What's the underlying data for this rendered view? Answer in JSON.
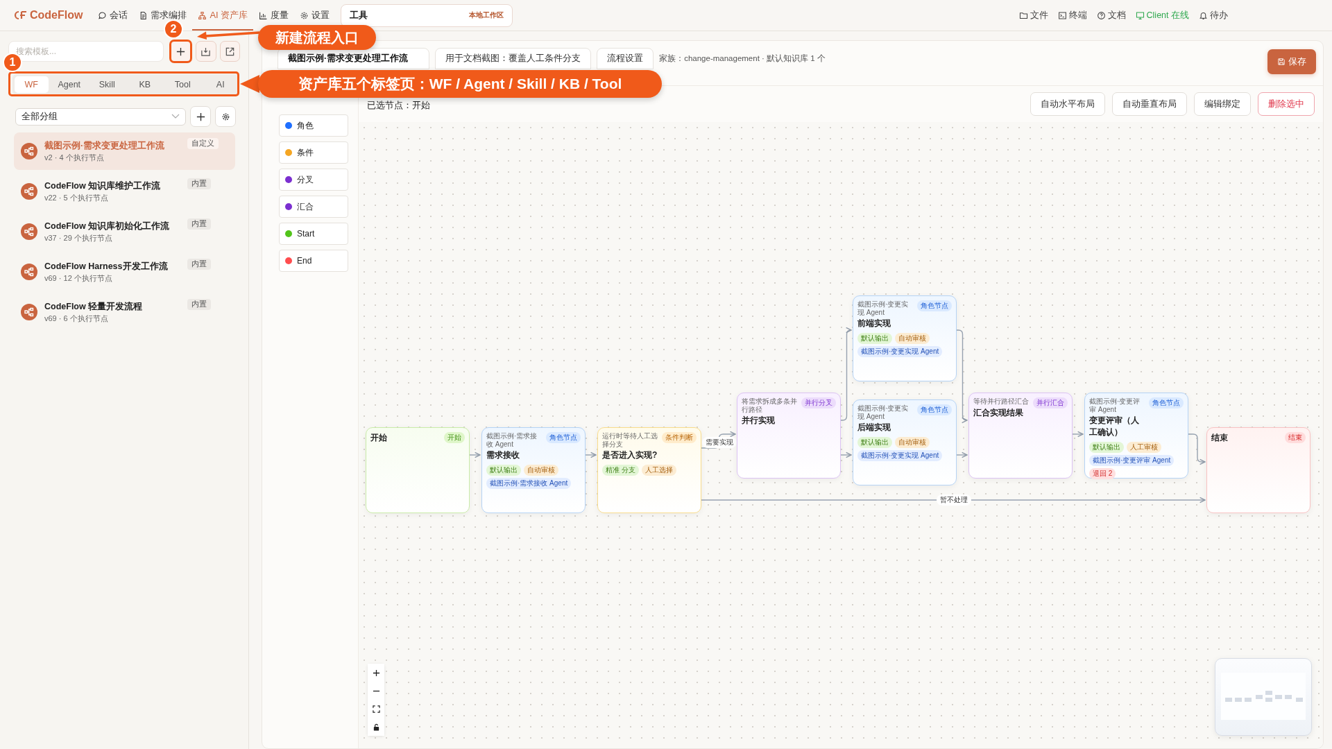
{
  "nav": {
    "logo": "CodeFlow",
    "items": [
      {
        "label": "会话",
        "selected": false
      },
      {
        "label": "需求编排",
        "selected": false
      },
      {
        "label": "AI 资产库",
        "selected": true
      },
      {
        "label": "度量",
        "selected": false
      },
      {
        "label": "设置",
        "selected": false
      }
    ],
    "workspace_tab": {
      "label": "工具",
      "badge": "本地工作区"
    },
    "right_items": [
      {
        "label": "文件",
        "online": false
      },
      {
        "label": "终端",
        "online": false
      },
      {
        "label": "文档",
        "online": false
      },
      {
        "label": "Client 在线",
        "online": true
      },
      {
        "label": "待办",
        "online": false
      }
    ]
  },
  "sidebar": {
    "search": {
      "placeholder": "搜索模板..."
    },
    "tabs": [
      {
        "label": "WF",
        "selected": true
      },
      {
        "label": "Agent",
        "selected": false
      },
      {
        "label": "Skill",
        "selected": false
      },
      {
        "label": "KB",
        "selected": false
      },
      {
        "label": "Tool",
        "selected": false
      },
      {
        "label": "AI",
        "selected": false
      }
    ],
    "group_select": "全部分组",
    "items": [
      {
        "title": "截图示例·需求变更处理工作流",
        "meta": "v2 · 4 个执行节点",
        "badge": "自定义",
        "selected": true
      },
      {
        "title": "CodeFlow 知识库维护工作流",
        "meta": "v22 · 5 个执行节点",
        "badge": "内置",
        "selected": false
      },
      {
        "title": "CodeFlow 知识库初始化工作流",
        "meta": "v37 · 29 个执行节点",
        "badge": "内置",
        "selected": false
      },
      {
        "title": "CodeFlow Harness开发工作流",
        "meta": "v69 · 12 个执行节点",
        "badge": "内置",
        "selected": false
      },
      {
        "title": "CodeFlow 轻量开发流程",
        "meta": "v69 · 6 个执行节点",
        "badge": "内置",
        "selected": false
      }
    ]
  },
  "editor": {
    "tabs": [
      {
        "label": "截图示例·需求变更处理工作流",
        "selected": true
      },
      {
        "label": "用于文档截图：覆盖人工条件分支",
        "selected": false
      },
      {
        "label": "流程设置",
        "selected": false
      }
    ],
    "family": "家族：change-management · 默认知识库 1 个",
    "save": "保存",
    "palette": [
      {
        "label": "角色",
        "color": "#1f6fff"
      },
      {
        "label": "条件",
        "color": "#f5a623"
      },
      {
        "label": "分叉",
        "color": "#7b2fd0"
      },
      {
        "label": "汇合",
        "color": "#7b2fd0"
      },
      {
        "label": "Start",
        "color": "#52c41a"
      },
      {
        "label": "End",
        "color": "#ff4d4f"
      }
    ],
    "selected_text": "已选节点：开始",
    "buttons": [
      {
        "label": "自动水平布局",
        "kind": "default"
      },
      {
        "label": "自动垂直布局",
        "kind": "default"
      },
      {
        "label": "编辑绑定",
        "kind": "default"
      },
      {
        "label": "删除选中",
        "kind": "danger"
      }
    ],
    "nodes": [
      {
        "kind": "start",
        "title": "开始",
        "badge": "开始"
      },
      {
        "kind": "role",
        "subtitle": "截图示例·需求接收 Agent",
        "title": "需求接收",
        "badge": "角色节点",
        "tags": [
          {
            "text": "默认输出",
            "kind": "output"
          },
          {
            "text": "自动审核",
            "kind": "review"
          },
          {
            "text": "截图示例·需求接收 Agent",
            "kind": "agent"
          }
        ]
      },
      {
        "kind": "condition",
        "subtitle": "运行时等待人工选择分支",
        "title": "是否进入实现?",
        "badge": "条件判断",
        "tags": [
          {
            "text": "精准 分支",
            "kind": "output"
          },
          {
            "text": "人工选择",
            "kind": "review"
          }
        ]
      },
      {
        "kind": "fork",
        "subtitle": "将需求拆成多条并行路径",
        "title": "并行实现",
        "badge": "并行分叉"
      },
      {
        "kind": "role",
        "subtitle": "截图示例·变更实现 Agent",
        "title": "前端实现",
        "badge": "角色节点",
        "tags": [
          {
            "text": "默认输出",
            "kind": "output"
          },
          {
            "text": "自动审核",
            "kind": "review"
          },
          {
            "text": "截图示例·变更实现 Agent",
            "kind": "agent"
          }
        ]
      },
      {
        "kind": "role",
        "subtitle": "截图示例·变更实现 Agent",
        "title": "后端实现",
        "badge": "角色节点",
        "tags": [
          {
            "text": "默认输出",
            "kind": "output"
          },
          {
            "text": "自动审核",
            "kind": "review"
          },
          {
            "text": "截图示例·变更实现 Agent",
            "kind": "agent"
          }
        ]
      },
      {
        "kind": "join",
        "subtitle": "等待并行路径汇合",
        "title": "汇合实现结果",
        "badge": "并行汇合"
      },
      {
        "kind": "role",
        "subtitle": "截图示例·变更评审 Agent",
        "title": "变更评审（人工确认）",
        "badge": "角色节点",
        "tags": [
          {
            "text": "默认输出",
            "kind": "output"
          },
          {
            "text": "人工审核",
            "kind": "review"
          },
          {
            "text": "截图示例·变更评审 Agent",
            "kind": "agent"
          },
          {
            "text": "退回 2",
            "kind": "return"
          }
        ]
      },
      {
        "kind": "end",
        "title": "结束",
        "badge": "结束"
      }
    ],
    "edge_labels": [
      "需要实现",
      "暂不处理"
    ]
  },
  "annotations": [
    {
      "number": "2",
      "text": "新建流程入口"
    },
    {
      "number": "1",
      "text": "资产库五个标签页：WF / Agent / Skill / KB / Tool"
    }
  ]
}
